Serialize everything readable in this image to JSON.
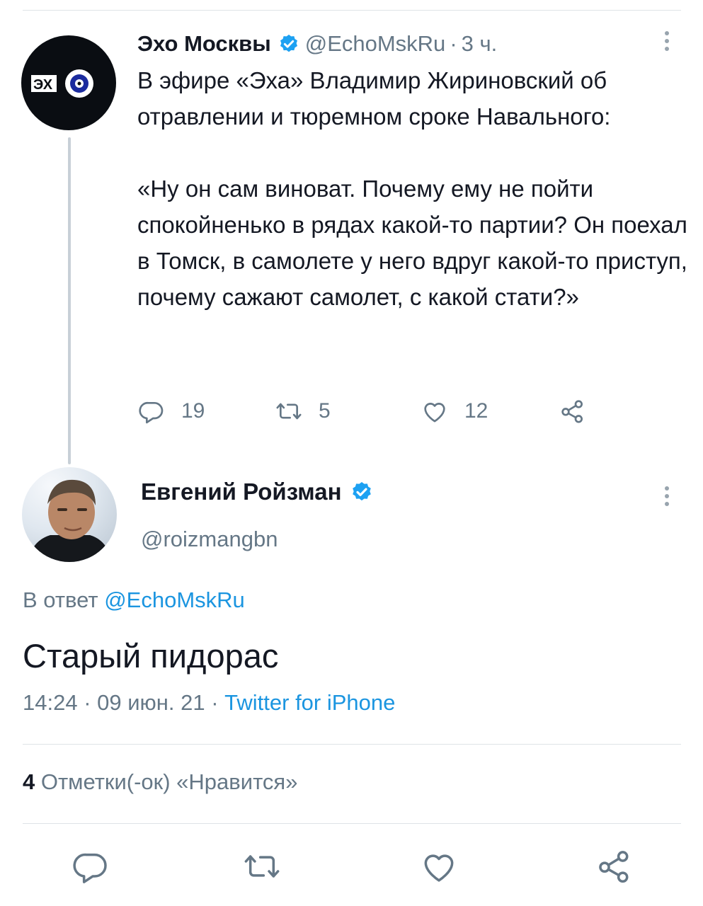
{
  "parent_tweet": {
    "author_name": "Эхо Москвы",
    "handle": "@EchoMskRu",
    "separator": "·",
    "time": "3 ч.",
    "avatar_logo_text": "ЭХО",
    "text_paragraph_1": "В эфире «Эха» Владимир Жириновский об отравлении и тюремном сроке Навального:",
    "text_paragraph_2": "«Ну он сам виноват. Почему ему не пойти спокойненько в рядах какой-то партии? Он поехал в Томск, в самолете у него вдруг какой-то приступ, почему сажают самолет, с какой стати?»",
    "replies": "19",
    "retweets": "5",
    "likes": "12",
    "icons": [
      "reply-icon",
      "retweet-icon",
      "like-icon",
      "share-icon",
      "more-icon",
      "verified-badge-icon"
    ]
  },
  "main_tweet": {
    "author_name": "Евгений Ройзман",
    "handle": "@roizmangbn",
    "reply_prefix": "В ответ",
    "reply_target": "@EchoMskRu",
    "text": "Старый пидорас",
    "timestamp": "14:24 · 09 июн. 21 · ",
    "source": "Twitter for iPhone",
    "like_count": "4",
    "like_label": "Отметки(-ок) «Нравится»",
    "icons": [
      "reply-icon",
      "retweet-icon",
      "like-icon",
      "share-icon",
      "more-icon",
      "verified-badge-icon"
    ]
  },
  "colors": {
    "accent": "#1b95e0",
    "verified": "#1da1f2",
    "secondary_text": "#657786",
    "divider": "#dfe3e7"
  }
}
